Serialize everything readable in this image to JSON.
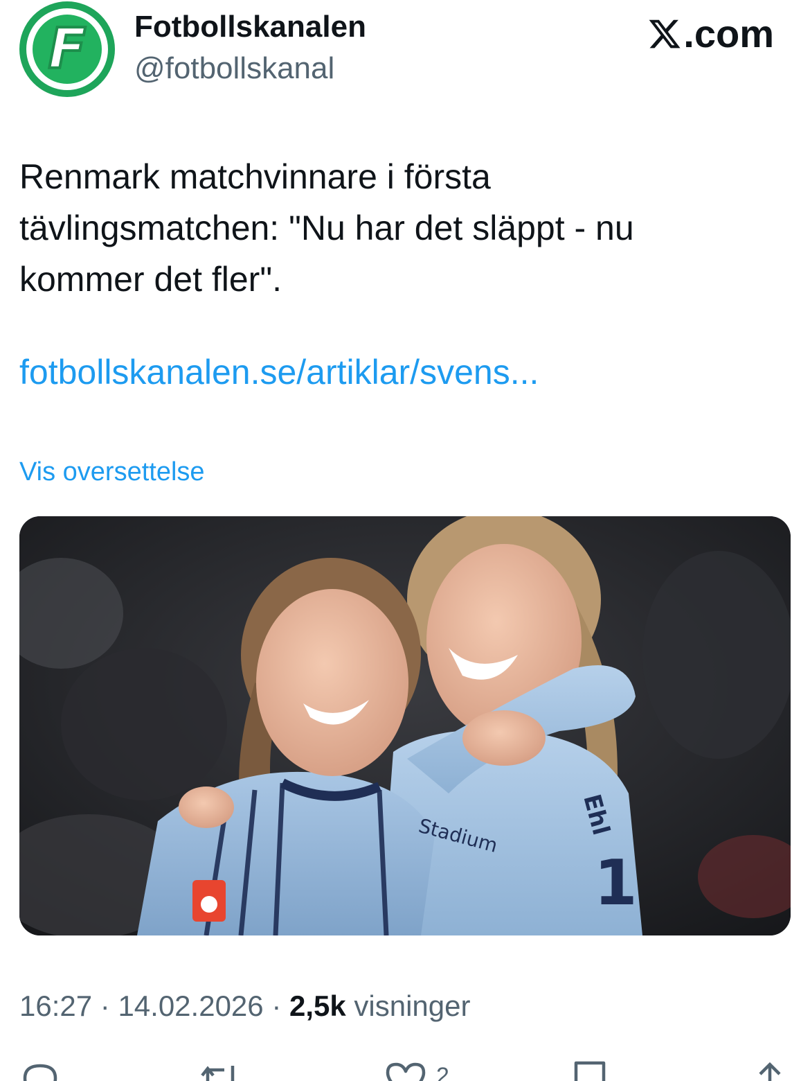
{
  "header": {
    "display_name": "Fotbollskanalen",
    "handle": "@fotbollskanal",
    "avatar_letter": "F",
    "brand_label": ".com",
    "brand_icon": "x-logo-icon"
  },
  "tweet": {
    "text": "Renmark matchvinnare i första\ntävlingsmatchen: \"Nu har det släppt - nu\nkommer det fler\".",
    "link_text": "fotbollskanalen.se/artiklar/svens...",
    "translate_label": "Vis oversettelse"
  },
  "media": {
    "jersey_sponsor": "Stadium",
    "jersey_name": "Ehl",
    "jersey_number": "1"
  },
  "meta": {
    "time": "16:27",
    "separator": " · ",
    "date": "14.02.2026",
    "views_count": "2,5k",
    "views_label": "visninger"
  },
  "actions": {
    "reply": {
      "icon": "reply-icon",
      "count": ""
    },
    "retweet": {
      "icon": "retweet-icon",
      "count": ""
    },
    "like": {
      "icon": "heart-icon",
      "count": "2"
    },
    "bookmark": {
      "icon": "bookmark-icon",
      "count": ""
    },
    "share": {
      "icon": "share-icon",
      "count": ""
    }
  },
  "colors": {
    "link": "#1d9bf0",
    "secondary_text": "#536471",
    "primary_text": "#0f1419",
    "avatar_green": "#22b25f"
  }
}
